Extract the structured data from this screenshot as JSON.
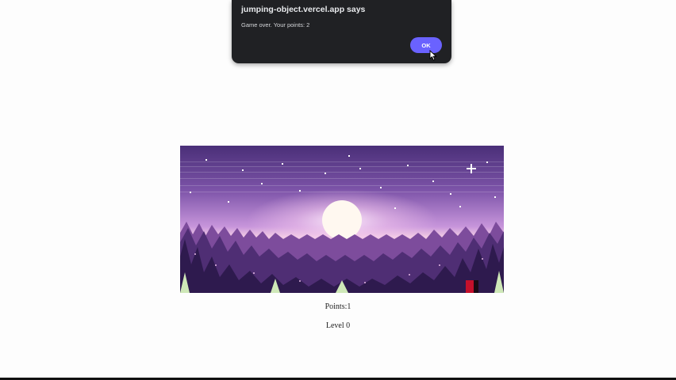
{
  "dialog": {
    "title": "jumping-object.vercel.app says",
    "message": "Game over. Your points: 2",
    "ok_label": "OK"
  },
  "game": {
    "scene": "pixel-art forest at sunset",
    "sky_top_color": "#5b3a86",
    "sky_mid_color": "#b77fd0",
    "sun_color": "#fff8f0",
    "player_color": "#c4102b"
  },
  "hud": {
    "points_text": "Points:1",
    "level_text": "Level 0"
  },
  "colors": {
    "dialog_bg": "#202124",
    "ok_button": "#6a62ff"
  }
}
